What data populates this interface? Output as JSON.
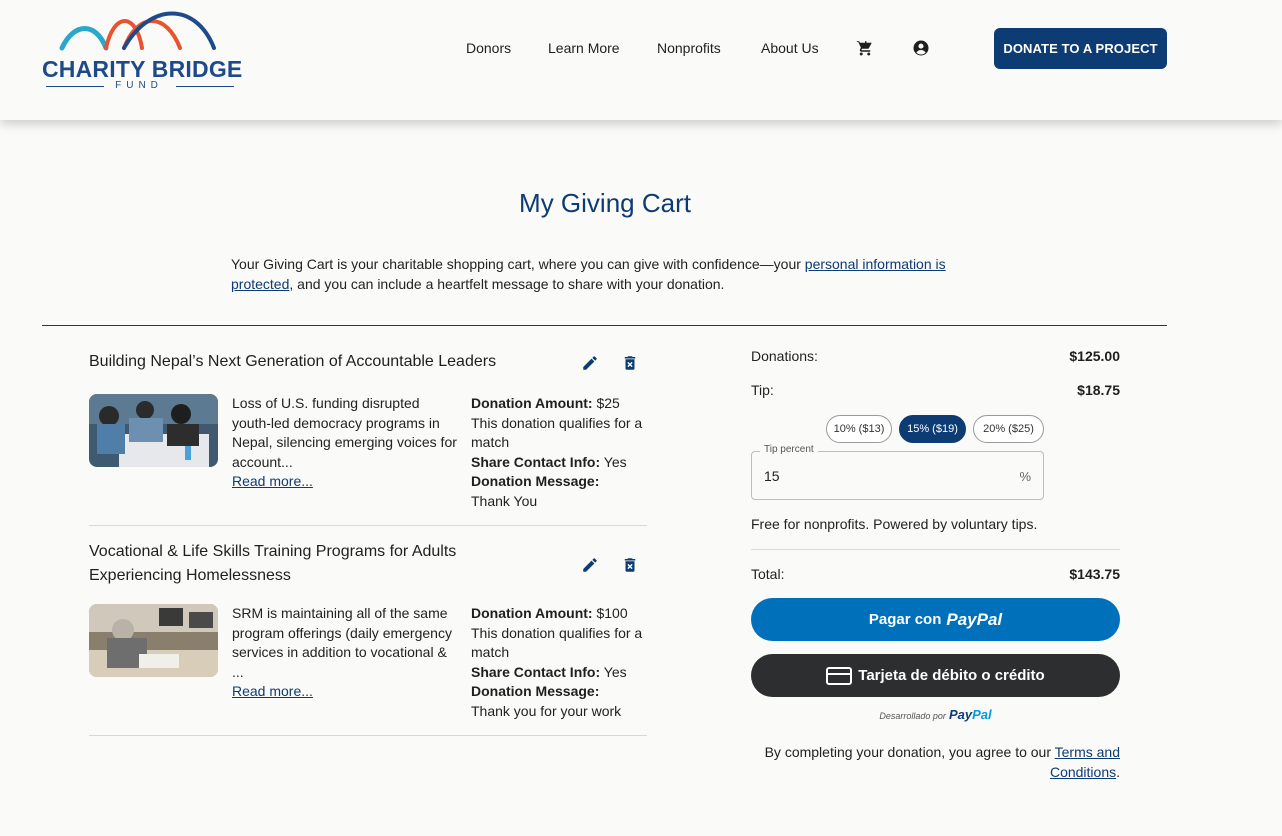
{
  "brand": {
    "logo_title": "CHARITY BRIDGE",
    "logo_sub": "FUND",
    "colors": {
      "primary": "#0d3b73",
      "accent_orange": "#e8542f",
      "accent_teal": "#2aa7c9",
      "paypal_blue": "#0070ba",
      "card_dark": "#2c2e2f"
    }
  },
  "nav": {
    "items": [
      "Donors",
      "Learn More",
      "Nonprofits",
      "About Us"
    ],
    "cart_icon": "cart-icon",
    "account_icon": "account-circle-icon",
    "cta": "DONATE TO A PROJECT"
  },
  "page": {
    "title": "My Giving Cart",
    "intro_before": "Your Giving Cart is your charitable shopping cart, where you can give with confidence—your ",
    "intro_link": "personal information is protected",
    "intro_after": ", and you can include a heartfelt message to share with your donation."
  },
  "cart": {
    "items": [
      {
        "title": "Building Nepal’s Next Generation of Accountable Leaders",
        "description": "Loss of U.S. funding disrupted youth-led democracy programs in Nepal, silencing emerging voices for account...",
        "read_more": "Read more...",
        "amount_label": "Donation Amount:",
        "amount": "$25",
        "match_note": "This donation qualifies for a match",
        "share_label": "Share Contact Info:",
        "share_value": "Yes",
        "message_label": "Donation Message:",
        "message": "Thank You"
      },
      {
        "title": "Vocational & Life Skills Training Programs for Adults Experiencing Homelessness",
        "description": "SRM is maintaining all of the same program offerings (daily emergency services in addition to vocational & ...",
        "read_more": "Read more...",
        "amount_label": "Donation Amount:",
        "amount": "$100",
        "match_note": "This donation qualifies for a match",
        "share_label": "Share Contact Info:",
        "share_value": "Yes",
        "message_label": "Donation Message:",
        "message": "Thank you for your work"
      }
    ]
  },
  "summary": {
    "donations_label": "Donations:",
    "donations_value": "$125.00",
    "tip_label": "Tip:",
    "tip_value": "$18.75",
    "tip_options": [
      "10% ($13)",
      "15% ($19)",
      "20% ($25)"
    ],
    "tip_selected_index": 1,
    "tip_field_label": "Tip percent",
    "tip_field_value": "15",
    "tip_field_unit": "%",
    "free_note": "Free for nonprofits. Powered by voluntary tips.",
    "total_label": "Total:",
    "total_value": "$143.75",
    "paypal_button_prefix": "Pagar con",
    "paypal_button_brand": "PayPal",
    "card_button": "Tarjeta de débito o crédito",
    "powered_by": "Desarrollado por",
    "powered_brand_pay": "Pay",
    "powered_brand_pal": "Pal",
    "terms_before": "By completing your donation, you agree to our ",
    "terms_link": "Terms and Conditions",
    "terms_after": "."
  }
}
